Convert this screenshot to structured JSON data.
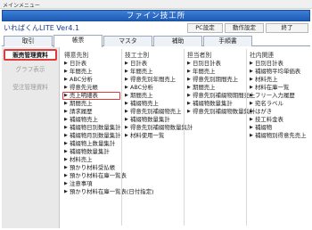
{
  "menubar": {
    "label": "メインメニュー"
  },
  "window": {
    "title": "ファイン技工所"
  },
  "header": {
    "app_name": "いればくんLITE Ver4.1",
    "buttons": [
      {
        "label": "PC設定"
      },
      {
        "label": "動作設定"
      },
      {
        "label": "終了"
      }
    ]
  },
  "tabs": [
    {
      "label": "取引"
    },
    {
      "label": "帳票",
      "active": true
    },
    {
      "label": "マスタ"
    },
    {
      "label": "補助"
    },
    {
      "label": "手順書"
    }
  ],
  "sidebar": {
    "items": [
      {
        "label": "販売管理資料",
        "active": true
      },
      {
        "label": "グラフ表示"
      },
      {
        "label": "受注管理資料"
      }
    ]
  },
  "columns": [
    {
      "heading": "得意先別",
      "items": [
        {
          "label": "日計表"
        },
        {
          "label": "年間売上"
        },
        {
          "label": "ABC分析"
        },
        {
          "label": "得意先元帳"
        },
        {
          "label": "売上明細表",
          "highlighted": true
        },
        {
          "label": "期間売上"
        },
        {
          "label": "請求履歴"
        },
        {
          "label": "補綴物売上"
        },
        {
          "label": "補綴物日別数量集計"
        },
        {
          "label": "補綴物月別数量集計"
        },
        {
          "label": "補綴物上数量集計"
        },
        {
          "label": "補綴物数量集計"
        },
        {
          "label": "材料売上"
        },
        {
          "label": "預かり材料受払帳"
        },
        {
          "label": "預かり材料在庫一覧表"
        },
        {
          "label": "注意事項"
        },
        {
          "label": "預かり材料在庫一覧表(日付指定)"
        }
      ]
    },
    {
      "heading": "技工士別",
      "items": [
        {
          "label": "日計表"
        },
        {
          "label": "年間売上"
        },
        {
          "label": "得意先別年間売上"
        },
        {
          "label": "ABC分析"
        },
        {
          "label": "期間売上"
        },
        {
          "label": "補綴物売上"
        },
        {
          "label": "得意先別補綴物売上"
        },
        {
          "label": "補綴物数量集計"
        },
        {
          "label": "得意先別補綴物数量集計"
        },
        {
          "label": "材料使用一覧"
        }
      ]
    },
    {
      "heading": "担当者別",
      "items": [
        {
          "label": "日別日計表"
        },
        {
          "label": "年間売上"
        },
        {
          "label": "得意先別期間売上"
        },
        {
          "label": "期間売上"
        },
        {
          "label": "得意先別補綴物期間売上"
        },
        {
          "label": "補綴物数量集計"
        },
        {
          "label": "得意先別補綴物数量集計"
        }
      ]
    },
    {
      "heading": "社内関連",
      "items": [
        {
          "label": "日別日計表"
        },
        {
          "label": "補綴物平均単価表"
        },
        {
          "label": "材料売上"
        },
        {
          "label": "材料在庫一覧"
        },
        {
          "label": "フリー入力履歴"
        },
        {
          "label": "宛名ラベル"
        },
        {
          "label": "はがき"
        },
        {
          "label": "技工料金表"
        },
        {
          "label": "補綴物"
        },
        {
          "label": "補綴物別得意先売上"
        }
      ]
    }
  ]
}
